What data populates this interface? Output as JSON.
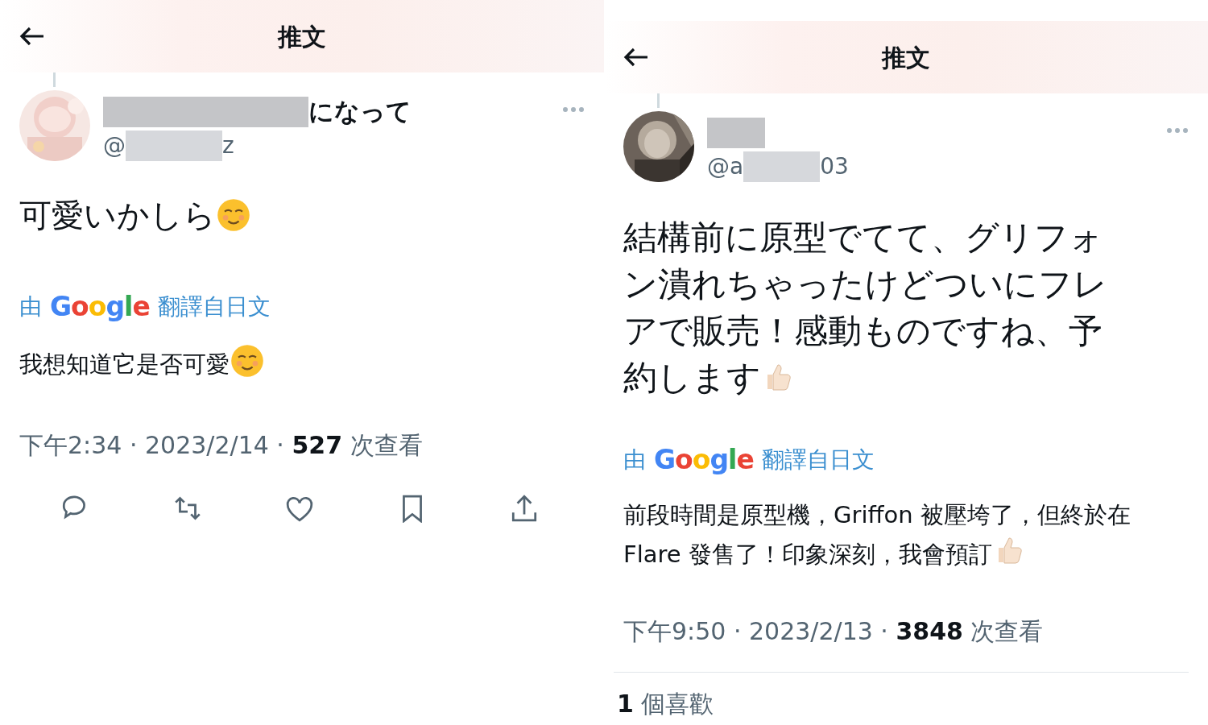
{
  "panels": [
    {
      "title": "推文",
      "author": {
        "name_visible": "になって",
        "handle_start": "@",
        "handle_end": "z"
      },
      "text": "可愛いかしら",
      "text_emoji": {
        "kind": "smile"
      },
      "translation": {
        "prefix": "由",
        "brand": "Google",
        "suffix": "翻譯自日文",
        "text": "我想知道它是否可愛",
        "emoji": {
          "kind": "smile"
        }
      },
      "meta": "下午2:34 · 2023/2/14 · **527** 次查看",
      "footer": {
        "kind": "actions"
      }
    },
    {
      "title": "推文",
      "author": {
        "handle_start": "@a",
        "handle_end": "03"
      },
      "text": "結構前に原型でてて、グリフォン潰れちゃったけどついにフレアで販売！感動ものですね、予約します",
      "text_emoji": {
        "kind": "thumb"
      },
      "translation": {
        "prefix": "由",
        "brand": "Google",
        "suffix": "翻譯自日文",
        "text": "前段時間是原型機，Griffon 被壓垮了，但終於在 Flare 發售了！印象深刻，我會預訂",
        "emoji": {
          "kind": "thumb"
        }
      },
      "meta": "下午9:50 · 2023/2/13 · **3848** 次查看",
      "footer": {
        "kind": "likes",
        "likes": "**1** 個喜歡"
      }
    }
  ]
}
